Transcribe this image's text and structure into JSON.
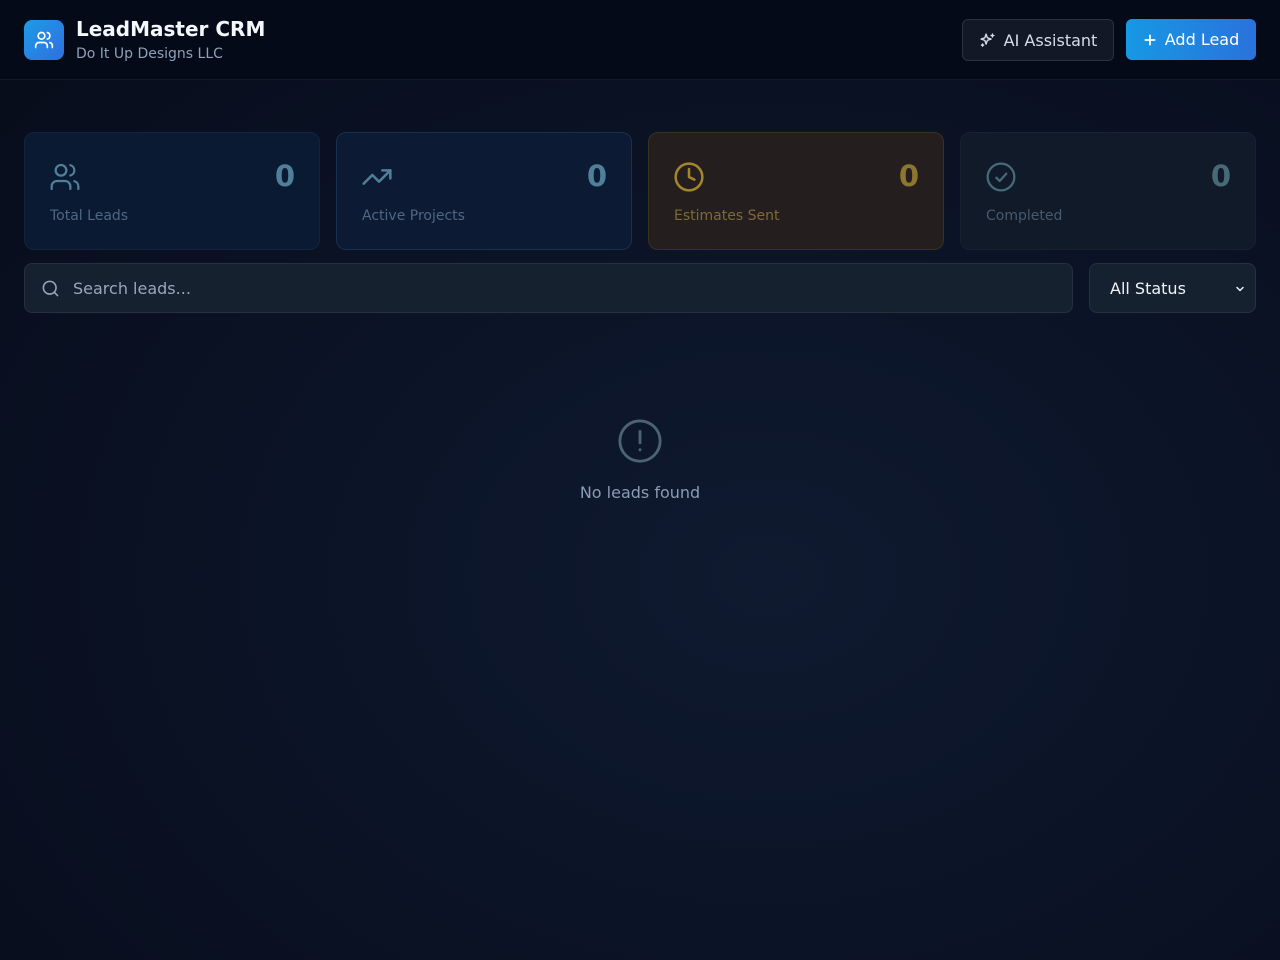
{
  "header": {
    "title": "LeadMaster CRM",
    "subtitle": "Do It Up Designs LLC",
    "logo_icon": "users-icon",
    "ai_button_label": "AI Assistant",
    "ai_button_icon": "sparkles-icon",
    "add_button_label": "Add Lead",
    "add_button_icon": "plus-icon"
  },
  "stats": [
    {
      "label": "Total Leads",
      "value": "0",
      "icon": "users-icon",
      "color": "#4f7f99"
    },
    {
      "label": "Active Projects",
      "value": "0",
      "icon": "trending-up-icon",
      "color": "#4f7f99"
    },
    {
      "label": "Estimates Sent",
      "value": "0",
      "icon": "clock-icon",
      "color": "#8e7630"
    },
    {
      "label": "Completed",
      "value": "0",
      "icon": "check-circle-icon",
      "color": "#466a78"
    }
  ],
  "search": {
    "placeholder": "Search leads...",
    "value": ""
  },
  "filter": {
    "selected": "All Status"
  },
  "empty_state": {
    "icon": "alert-circle-icon",
    "message": "No leads found"
  },
  "colors": {
    "accent": "#1e9be6",
    "background": "#0b1326",
    "header_bg": "#050a18"
  }
}
